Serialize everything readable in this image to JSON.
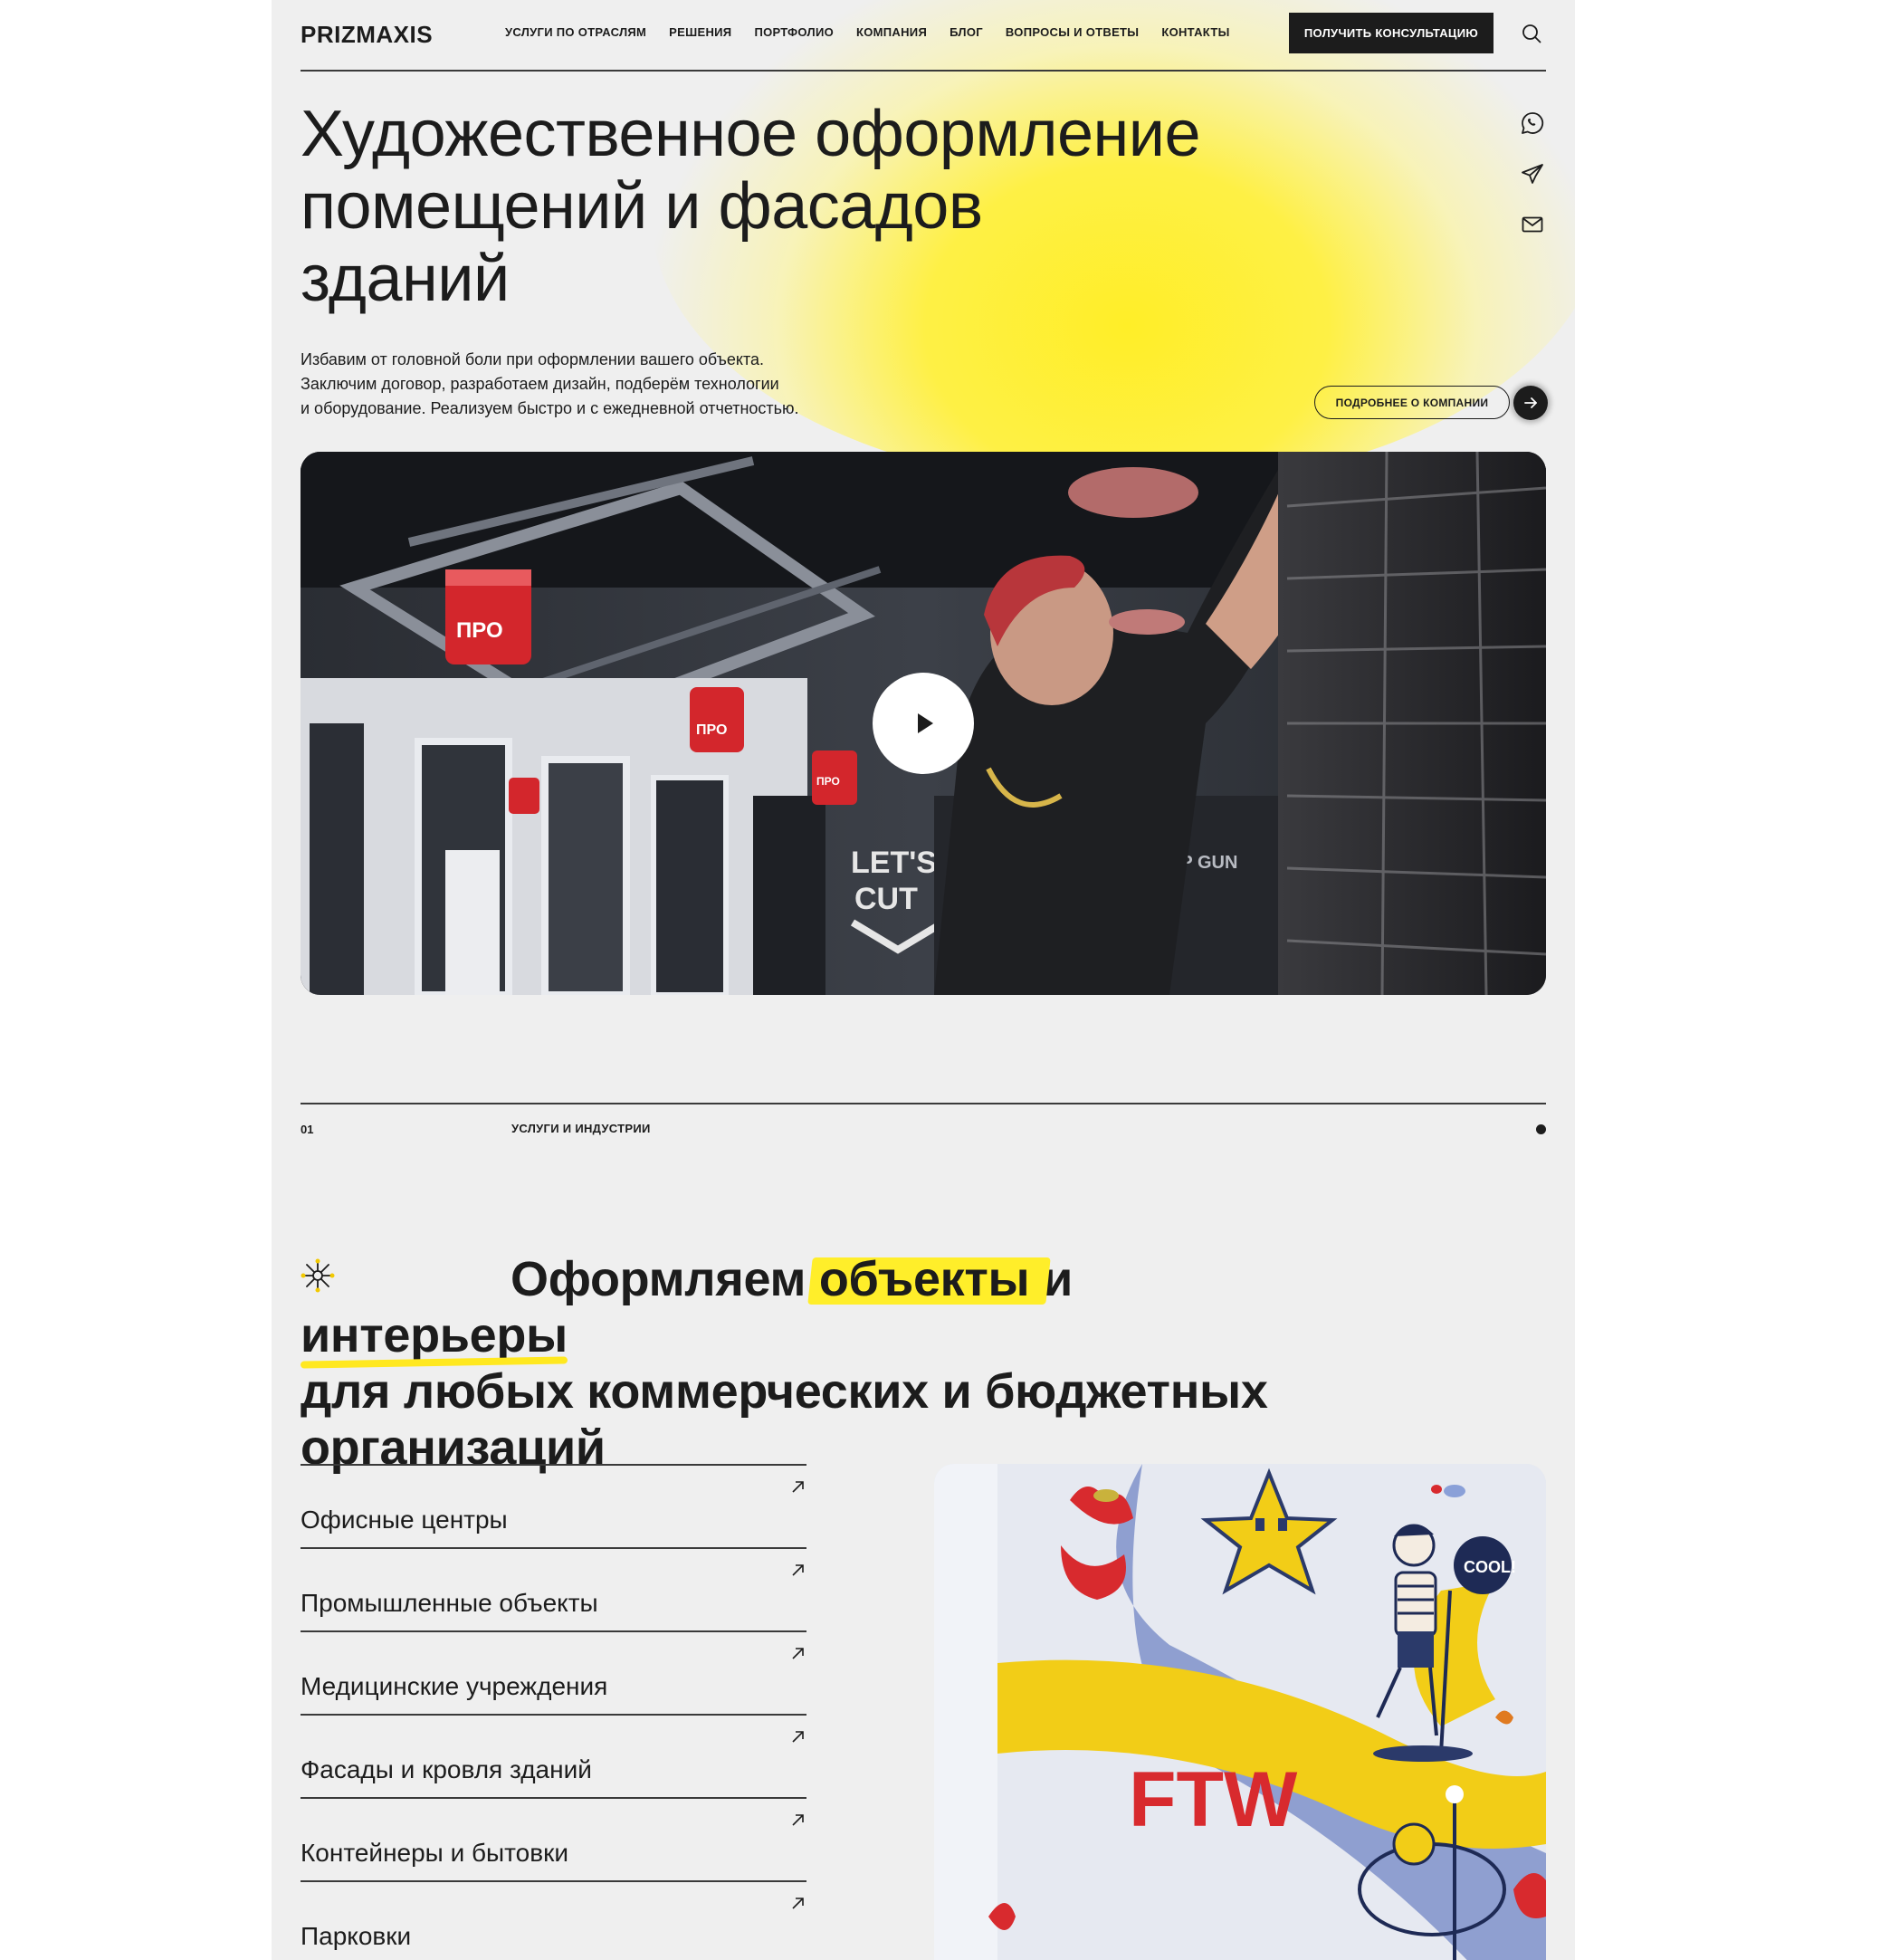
{
  "header": {
    "logo": "PRIZMAXIS",
    "nav": [
      "УСЛУГИ ПО ОТРАСЛЯМ",
      "РЕШЕНИЯ",
      "ПОРТФОЛИО",
      "КОМПАНИЯ",
      "БЛОГ",
      "ВОПРОСЫ И ОТВЕТЫ",
      "КОНТАКТЫ"
    ],
    "cta": "ПОЛУЧИТЬ КОНСУЛЬТАЦИЮ"
  },
  "hero": {
    "title_line1": "Художественное оформление",
    "title_line2": "помещений и фасадов зданий",
    "subtitle": [
      "Избавим от головной боли при оформлении вашего объекта.",
      "Заключим договор, разработаем дизайн, подберём технологии",
      "и оборудование. Реализуем быстро и с ежедневной отчетностью."
    ],
    "more_button": "ПОДРОБНЕЕ О КОМПАНИИ",
    "video_signs": {
      "sign1": "ПРО",
      "sign2": "ПРО",
      "sign3": "ПРО",
      "sign4": "LET'S",
      "sign5": "CUT",
      "sign6": "TOP GUN"
    }
  },
  "section": {
    "number": "01",
    "label": "УСЛУГИ И ИНДУСТРИИ",
    "title_part1": "Оформляем",
    "title_highlight": "объекты",
    "title_part2": "и",
    "title_underline": "интерьеры",
    "title_line2": "для любых коммерческих и бюджетных",
    "title_line3": "организаций"
  },
  "services": [
    "Офисные центры",
    "Промышленные объекты",
    "Медицинские учреждения",
    "Фасады и кровля зданий",
    "Контейнеры и бытовки",
    "Парковки"
  ],
  "mural": {
    "bubble": "COOL!",
    "letters": "FTW"
  },
  "colors": {
    "accent_yellow": "#ffee2a",
    "dark": "#1c1c1c",
    "page_bg": "#efefef"
  },
  "icons": [
    "search-icon",
    "whatsapp-icon",
    "telegram-icon",
    "mail-icon",
    "arrow-right-icon",
    "play-icon",
    "asterisk-icon",
    "arrow-up-right-icon"
  ]
}
